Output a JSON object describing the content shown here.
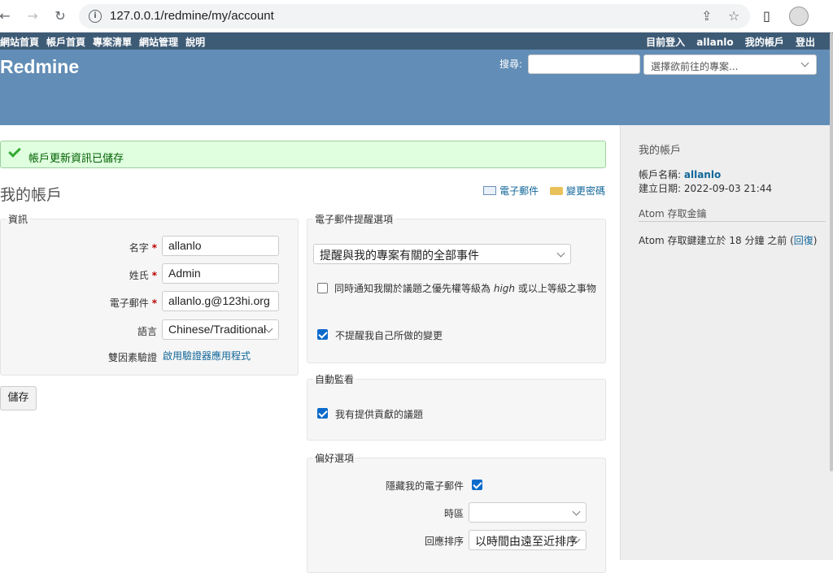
{
  "browser": {
    "url": "127.0.0.1/redmine/my/account"
  },
  "topmenu": {
    "left_items": [
      "網站首頁",
      "帳戶首頁",
      "專案清單",
      "網站管理",
      "說明"
    ],
    "logged_in_prefix": "目前登入",
    "username": "allanlo",
    "my_account": "我的帳戶",
    "logout": "登出"
  },
  "header": {
    "title": "Redmine",
    "search_label": "搜尋:",
    "project_jump": "選擇欲前往的專案..."
  },
  "flash": {
    "notice": "帳戶更新資訊已儲存"
  },
  "page": {
    "title": "我的帳戶",
    "email_link": "電子郵件",
    "password_link": "變更密碼"
  },
  "info": {
    "legend": "資訊",
    "firstname_label": "名字",
    "firstname_value": "allanlo",
    "lastname_label": "姓氏",
    "lastname_value": "Admin",
    "email_label": "電子郵件",
    "email_value": "allanlo.g@123hi.org",
    "language_label": "語言",
    "language_value": "Chinese/Traditional",
    "twofa_label": "雙因素驗證",
    "twofa_link": "啟用驗證器應用程式",
    "required_mark": "*"
  },
  "save_button": "儲存",
  "mail_notification": {
    "legend": "電子郵件提醒選項",
    "selected": "提醒與我的專案有關的全部事件",
    "high_priority_pre": "同時通知我關於議題之優先權等級為",
    "high_priority_em": "high",
    "high_priority_post": "或以上等級之事物",
    "high_priority_checked": false,
    "no_self_notified": "不提醒我自己所做的變更",
    "no_self_notified_checked": true
  },
  "auto_watch": {
    "legend": "自動監看",
    "contributed": "我有提供貢獻的議題",
    "contributed_checked": true
  },
  "preferences": {
    "legend": "偏好選項",
    "hide_mail": "隱藏我的電子郵件",
    "hide_mail_checked": true,
    "timezone_label": "時區",
    "timezone_value": "",
    "comments_order_label": "回應排序",
    "comments_order_value": "以時間由遠至近排序"
  },
  "sidebar": {
    "title": "我的帳戶",
    "login_label": "帳戶名稱:",
    "login_value": "allanlo",
    "created_label": "建立日期:",
    "created_value": "2022-09-03 21:44",
    "atom_title": "Atom 存取金鑰",
    "atom_created_text": "Atom 存取鍵建立於 18 分鐘 之前 (",
    "atom_reset_link": "回復",
    "atom_close": ")"
  },
  "icons": [
    "back-arrow-icon",
    "forward-arrow-icon",
    "reload-icon",
    "info-icon",
    "share-icon",
    "star-icon",
    "sidebar-toggle-icon",
    "profile-avatar-icon",
    "checkmark-icon",
    "email-icon",
    "key-icon",
    "chevron-down-icon"
  ]
}
